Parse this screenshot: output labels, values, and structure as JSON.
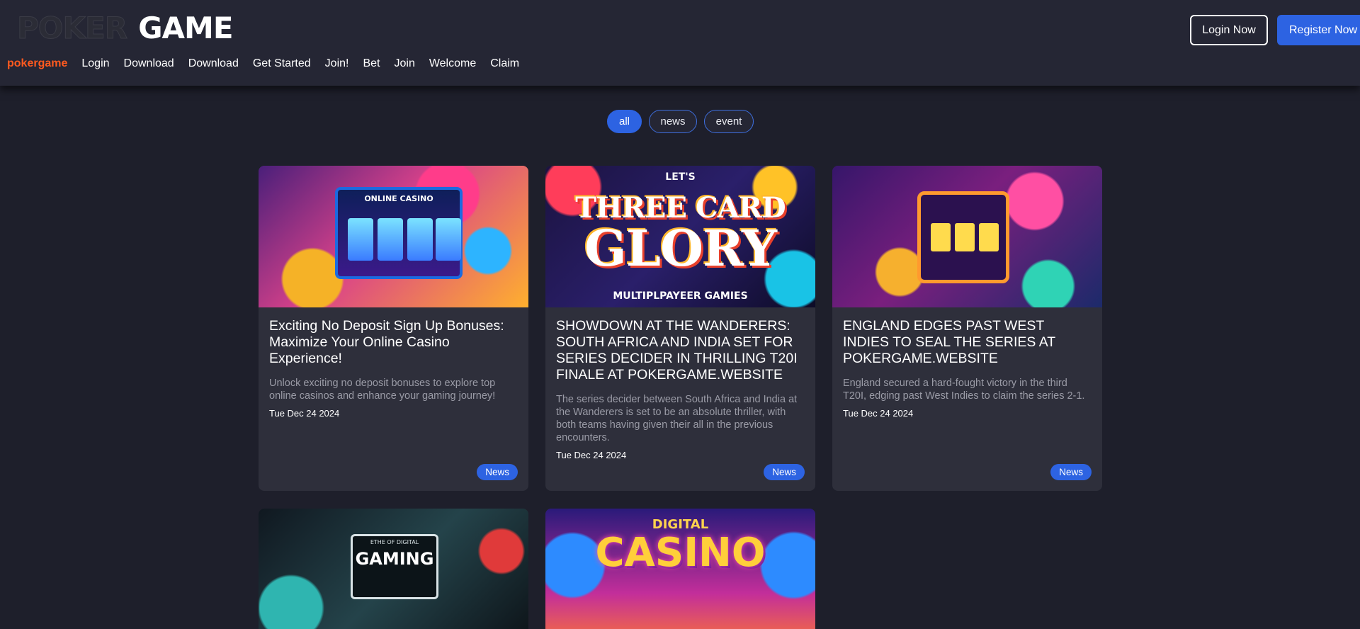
{
  "header": {
    "logo": {
      "part1": "POKER",
      "part2": "GAME"
    },
    "login_label": "Login Now",
    "register_label": "Register Now"
  },
  "nav": {
    "items": [
      {
        "label": "pokergame",
        "active": true
      },
      {
        "label": "Login"
      },
      {
        "label": "Download"
      },
      {
        "label": "Download"
      },
      {
        "label": "Get Started"
      },
      {
        "label": "Join!"
      },
      {
        "label": "Bet"
      },
      {
        "label": "Join"
      },
      {
        "label": "Welcome"
      },
      {
        "label": "Claim"
      }
    ]
  },
  "filters": {
    "items": [
      {
        "label": "all",
        "active": true
      },
      {
        "label": "news"
      },
      {
        "label": "event"
      }
    ]
  },
  "cards": [
    {
      "image_text": [
        "ONLINE CASINO"
      ],
      "title": "Exciting No Deposit Sign Up Bonuses: Maximize Your Online Casino Experience!",
      "excerpt": "Unlock exciting no deposit bonuses to explore top online casinos and enhance your gaming journey!",
      "date": "Tue Dec 24 2024",
      "tag": "News"
    },
    {
      "image_text": [
        "LET'S",
        "THREE CARD",
        "GLORY",
        "MULTIPLPAYEER GAMIES"
      ],
      "title": "SHOWDOWN AT THE WANDERERS: SOUTH AFRICA AND INDIA SET FOR SERIES DECIDER IN THRILLING T20I FINALE AT POKERGAME.WEBSITE",
      "excerpt": "The series decider between South Africa and India at the Wanderers is set to be an absolute thriller, with both teams having given their all in the previous encounters.",
      "date": "Tue Dec 24 2024",
      "tag": "News"
    },
    {
      "image_text": [],
      "title": "ENGLAND EDGES PAST WEST INDIES TO SEAL THE SERIES AT POKERGAME.WEBSITE",
      "excerpt": "England secured a hard-fought victory in the third T20I, edging past West Indies to claim the series 2-1.",
      "date": "Tue Dec 24 2024",
      "tag": "News"
    },
    {
      "image_text": [
        "ETHE OF DIGITAL",
        "GAMING"
      ]
    },
    {
      "image_text": [
        "DIGITAL",
        "CASINO"
      ]
    }
  ],
  "colors": {
    "background": "#1e1f2b",
    "header": "#252634",
    "card": "#2e2f3b",
    "accent": "#2d63e2",
    "active_nav": "#ff5a1f",
    "excerpt": "#9a9ba6"
  }
}
